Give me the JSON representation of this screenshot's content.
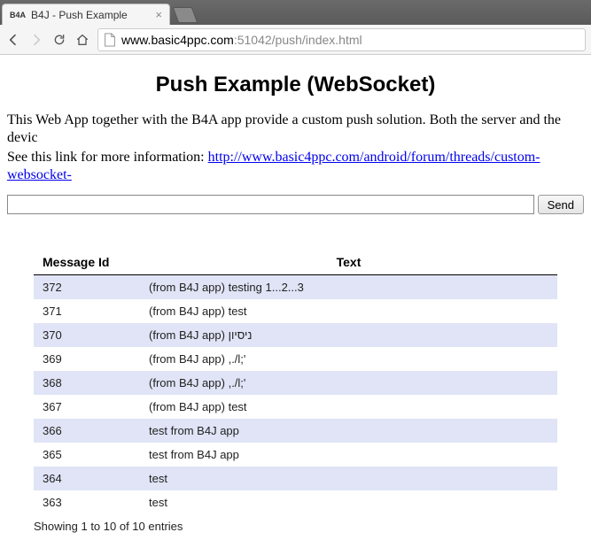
{
  "browser": {
    "tab_title": "B4J - Push Example",
    "favicon_text": "B4A",
    "url_host": "www.basic4ppc.com",
    "url_port": ":51042",
    "url_path": "/push/index.html"
  },
  "page": {
    "title": "Push Example (WebSocket)",
    "para1": "This Web App together with the B4A app provide a custom push solution. Both the server and the devic",
    "para2_prefix": "See this link for more information: ",
    "para2_link_text": "http://www.basic4ppc.com/android/forum/threads/custom-websocket-",
    "send_label": "Send",
    "input_value": ""
  },
  "table": {
    "headers": {
      "id": "Message Id",
      "text": "Text"
    },
    "rows": [
      {
        "id": "372",
        "text": "(from B4J app) testing 1...2...3"
      },
      {
        "id": "371",
        "text": "(from B4J app) test"
      },
      {
        "id": "370",
        "text": "(from B4J app) ניסיון"
      },
      {
        "id": "369",
        "text": "(from B4J app) ,./l;'"
      },
      {
        "id": "368",
        "text": "(from B4J app) ,./l;'"
      },
      {
        "id": "367",
        "text": "(from B4J app) test"
      },
      {
        "id": "366",
        "text": "test from B4J app"
      },
      {
        "id": "365",
        "text": "test from B4J app"
      },
      {
        "id": "364",
        "text": "test"
      },
      {
        "id": "363",
        "text": "test"
      }
    ],
    "info": "Showing 1 to 10 of 10 entries"
  }
}
